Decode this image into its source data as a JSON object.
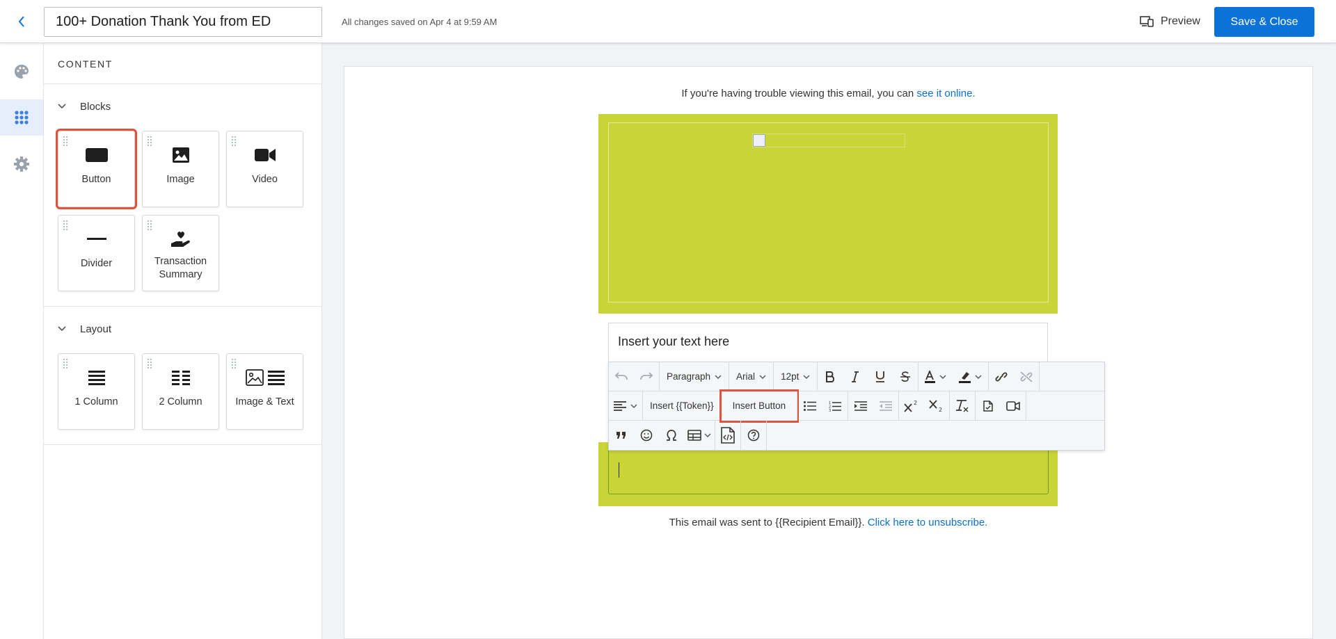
{
  "header": {
    "title_value": "100+ Donation Thank You from ED",
    "save_status": "All changes saved on Apr 4 at 9:59 AM",
    "preview_label": "Preview",
    "save_close_label": "Save & Close"
  },
  "rail": {
    "items": [
      "palette-icon",
      "grid-icon",
      "gear-icon"
    ],
    "active": "grid-icon"
  },
  "panel": {
    "title": "CONTENT",
    "blocks_heading": "Blocks",
    "blocks": [
      {
        "label": "Button",
        "icon": "button-icon"
      },
      {
        "label": "Image",
        "icon": "image-icon"
      },
      {
        "label": "Video",
        "icon": "video-icon"
      },
      {
        "label": "Divider",
        "icon": "divider-icon"
      },
      {
        "label": "Transaction Summary",
        "icon": "heart-hand-icon"
      }
    ],
    "layout_heading": "Layout",
    "layouts": [
      {
        "label": "1 Column",
        "icon": "one-column-icon"
      },
      {
        "label": "2 Column",
        "icon": "two-column-icon"
      },
      {
        "label": "Image & Text",
        "icon": "image-text-icon"
      }
    ]
  },
  "email": {
    "top_note_prefix": "If you're having trouble viewing this email, you can ",
    "top_note_link": "see it online.",
    "text_placeholder": "Insert your text here",
    "footer_prefix": "This email was sent to {{Recipient Email}}. ",
    "footer_link": "Click here to unsubscribe."
  },
  "toolbar": {
    "paragraph": "Paragraph",
    "font": "Arial",
    "size": "12pt",
    "insert_token": "Insert {{Token}}",
    "insert_button": "Insert Button"
  },
  "colors": {
    "accent": "#0b72d8",
    "banner": "#c8d438",
    "highlight": "#e0533f"
  }
}
